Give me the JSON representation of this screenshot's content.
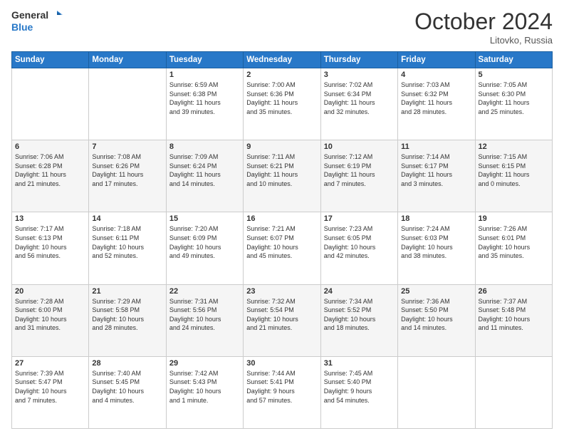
{
  "logo": {
    "general": "General",
    "blue": "Blue"
  },
  "title": "October 2024",
  "location": "Litovko, Russia",
  "days_header": [
    "Sunday",
    "Monday",
    "Tuesday",
    "Wednesday",
    "Thursday",
    "Friday",
    "Saturday"
  ],
  "weeks": [
    [
      {
        "day": "",
        "info": ""
      },
      {
        "day": "",
        "info": ""
      },
      {
        "day": "1",
        "info": "Sunrise: 6:59 AM\nSunset: 6:38 PM\nDaylight: 11 hours\nand 39 minutes."
      },
      {
        "day": "2",
        "info": "Sunrise: 7:00 AM\nSunset: 6:36 PM\nDaylight: 11 hours\nand 35 minutes."
      },
      {
        "day": "3",
        "info": "Sunrise: 7:02 AM\nSunset: 6:34 PM\nDaylight: 11 hours\nand 32 minutes."
      },
      {
        "day": "4",
        "info": "Sunrise: 7:03 AM\nSunset: 6:32 PM\nDaylight: 11 hours\nand 28 minutes."
      },
      {
        "day": "5",
        "info": "Sunrise: 7:05 AM\nSunset: 6:30 PM\nDaylight: 11 hours\nand 25 minutes."
      }
    ],
    [
      {
        "day": "6",
        "info": "Sunrise: 7:06 AM\nSunset: 6:28 PM\nDaylight: 11 hours\nand 21 minutes."
      },
      {
        "day": "7",
        "info": "Sunrise: 7:08 AM\nSunset: 6:26 PM\nDaylight: 11 hours\nand 17 minutes."
      },
      {
        "day": "8",
        "info": "Sunrise: 7:09 AM\nSunset: 6:24 PM\nDaylight: 11 hours\nand 14 minutes."
      },
      {
        "day": "9",
        "info": "Sunrise: 7:11 AM\nSunset: 6:21 PM\nDaylight: 11 hours\nand 10 minutes."
      },
      {
        "day": "10",
        "info": "Sunrise: 7:12 AM\nSunset: 6:19 PM\nDaylight: 11 hours\nand 7 minutes."
      },
      {
        "day": "11",
        "info": "Sunrise: 7:14 AM\nSunset: 6:17 PM\nDaylight: 11 hours\nand 3 minutes."
      },
      {
        "day": "12",
        "info": "Sunrise: 7:15 AM\nSunset: 6:15 PM\nDaylight: 11 hours\nand 0 minutes."
      }
    ],
    [
      {
        "day": "13",
        "info": "Sunrise: 7:17 AM\nSunset: 6:13 PM\nDaylight: 10 hours\nand 56 minutes."
      },
      {
        "day": "14",
        "info": "Sunrise: 7:18 AM\nSunset: 6:11 PM\nDaylight: 10 hours\nand 52 minutes."
      },
      {
        "day": "15",
        "info": "Sunrise: 7:20 AM\nSunset: 6:09 PM\nDaylight: 10 hours\nand 49 minutes."
      },
      {
        "day": "16",
        "info": "Sunrise: 7:21 AM\nSunset: 6:07 PM\nDaylight: 10 hours\nand 45 minutes."
      },
      {
        "day": "17",
        "info": "Sunrise: 7:23 AM\nSunset: 6:05 PM\nDaylight: 10 hours\nand 42 minutes."
      },
      {
        "day": "18",
        "info": "Sunrise: 7:24 AM\nSunset: 6:03 PM\nDaylight: 10 hours\nand 38 minutes."
      },
      {
        "day": "19",
        "info": "Sunrise: 7:26 AM\nSunset: 6:01 PM\nDaylight: 10 hours\nand 35 minutes."
      }
    ],
    [
      {
        "day": "20",
        "info": "Sunrise: 7:28 AM\nSunset: 6:00 PM\nDaylight: 10 hours\nand 31 minutes."
      },
      {
        "day": "21",
        "info": "Sunrise: 7:29 AM\nSunset: 5:58 PM\nDaylight: 10 hours\nand 28 minutes."
      },
      {
        "day": "22",
        "info": "Sunrise: 7:31 AM\nSunset: 5:56 PM\nDaylight: 10 hours\nand 24 minutes."
      },
      {
        "day": "23",
        "info": "Sunrise: 7:32 AM\nSunset: 5:54 PM\nDaylight: 10 hours\nand 21 minutes."
      },
      {
        "day": "24",
        "info": "Sunrise: 7:34 AM\nSunset: 5:52 PM\nDaylight: 10 hours\nand 18 minutes."
      },
      {
        "day": "25",
        "info": "Sunrise: 7:36 AM\nSunset: 5:50 PM\nDaylight: 10 hours\nand 14 minutes."
      },
      {
        "day": "26",
        "info": "Sunrise: 7:37 AM\nSunset: 5:48 PM\nDaylight: 10 hours\nand 11 minutes."
      }
    ],
    [
      {
        "day": "27",
        "info": "Sunrise: 7:39 AM\nSunset: 5:47 PM\nDaylight: 10 hours\nand 7 minutes."
      },
      {
        "day": "28",
        "info": "Sunrise: 7:40 AM\nSunset: 5:45 PM\nDaylight: 10 hours\nand 4 minutes."
      },
      {
        "day": "29",
        "info": "Sunrise: 7:42 AM\nSunset: 5:43 PM\nDaylight: 10 hours\nand 1 minute."
      },
      {
        "day": "30",
        "info": "Sunrise: 7:44 AM\nSunset: 5:41 PM\nDaylight: 9 hours\nand 57 minutes."
      },
      {
        "day": "31",
        "info": "Sunrise: 7:45 AM\nSunset: 5:40 PM\nDaylight: 9 hours\nand 54 minutes."
      },
      {
        "day": "",
        "info": ""
      },
      {
        "day": "",
        "info": ""
      }
    ]
  ]
}
